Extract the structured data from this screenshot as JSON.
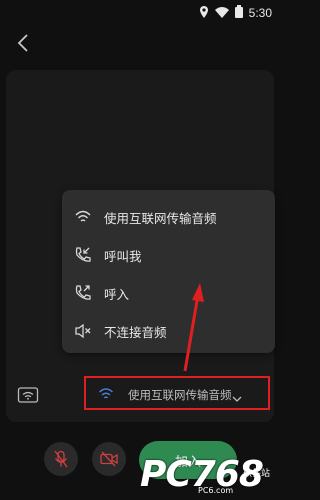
{
  "status_bar": {
    "time": "5:30"
  },
  "audio_menu": {
    "items": [
      {
        "label": "使用互联网传输音频",
        "icon": "wifi-icon"
      },
      {
        "label": "呼叫我",
        "icon": "phone-callback-icon"
      },
      {
        "label": "呼入",
        "icon": "phone-incoming-icon"
      },
      {
        "label": "不连接音频",
        "icon": "speaker-mute-icon"
      }
    ]
  },
  "audio_selector": {
    "label": "使用互联网传输音频",
    "icon": "wifi-icon"
  },
  "join_button": {
    "label": "加入"
  },
  "watermark": {
    "logo_text": "PC768",
    "sub": "软件站",
    "sub2": "PC6.com"
  },
  "colors": {
    "accent_green": "#2f8a52",
    "highlight_red": "#e02020",
    "menu_bg": "#2e2e2e"
  }
}
